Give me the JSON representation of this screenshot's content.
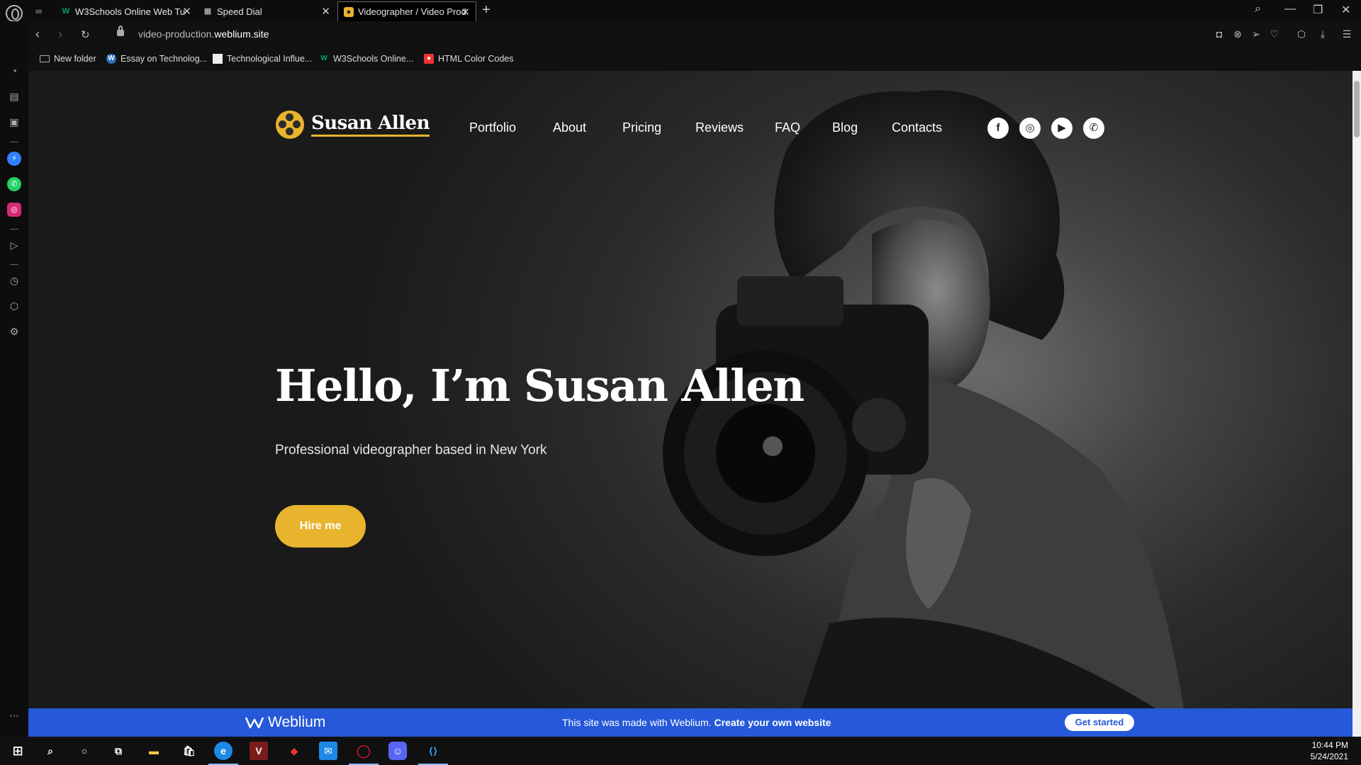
{
  "browser": {
    "tabs": [
      {
        "title": "W3Schools Online Web Tu",
        "active": false
      },
      {
        "title": "Speed Dial",
        "active": false
      },
      {
        "title": "Videographer / Video Prod",
        "active": true
      }
    ],
    "address": {
      "prefix": "video-production.",
      "domain": "weblium.site"
    },
    "bookmarks": [
      "New folder",
      "Essay on Technolog...",
      "Technological Influe...",
      "W3Schools Online...",
      "HTML Color Codes"
    ]
  },
  "site": {
    "logo_text": "Susan Allen",
    "menu": [
      "Portfolio",
      "About",
      "Pricing",
      "Reviews",
      "FAQ",
      "Blog",
      "Contacts"
    ],
    "social": [
      "facebook-icon",
      "instagram-icon",
      "youtube-icon",
      "whatsapp-icon"
    ],
    "hero": {
      "title": "Hello, I’m Susan Allen",
      "subtitle": "Professional videographer based in New York",
      "cta": "Hire me"
    },
    "accent": "#e8b42e"
  },
  "banner": {
    "brand": "Weblium",
    "text_prefix": "This site was made with ",
    "text_brand": "Weblium",
    "text_suffix": ". ",
    "text_cta": "Create your own website",
    "button": "Get started",
    "color": "#2659d9"
  },
  "taskbar": {
    "time": "10:44 PM",
    "date": "5/24/2021"
  }
}
